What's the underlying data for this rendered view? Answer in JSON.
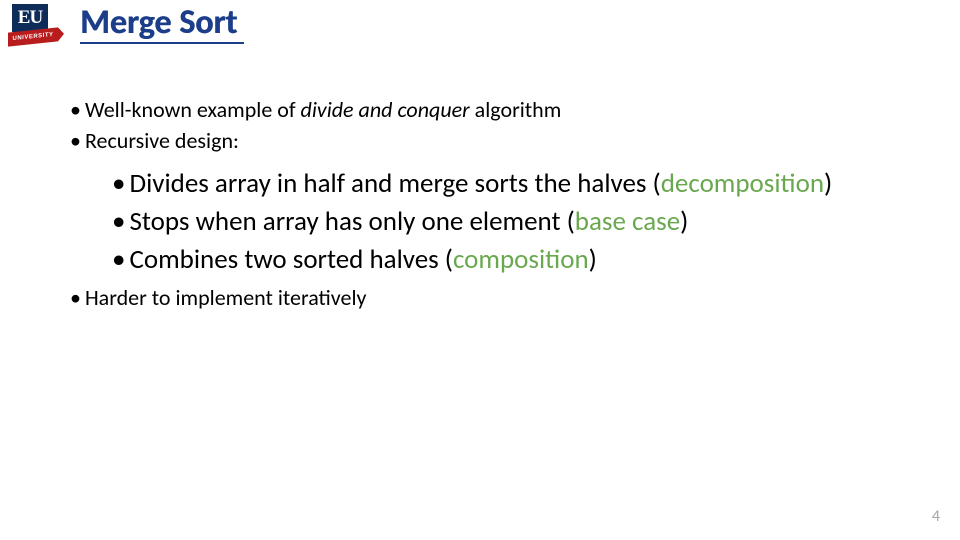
{
  "logo": {
    "initials": "EU",
    "ribbon": "UNIVERSITY"
  },
  "title": "Merge Sort",
  "bullets": {
    "l1_a_pre": "Well-known example of ",
    "l1_a_ital": "divide and conquer",
    "l1_a_post": " algorithm",
    "l1_b": "Recursive design:",
    "l2_a_pre": "Divides array in half and merge sorts the halves (",
    "l2_a_green": "decomposition",
    "l2_a_post": ")",
    "l2_b_pre": "Stops when array has only one element (",
    "l2_b_green": "base case",
    "l2_b_post": ")",
    "l2_c_pre": "Combines two sorted halves (",
    "l2_c_green": "composition",
    "l2_c_post": ")",
    "l1_c": "Harder to implement iteratively"
  },
  "page_number": "4"
}
